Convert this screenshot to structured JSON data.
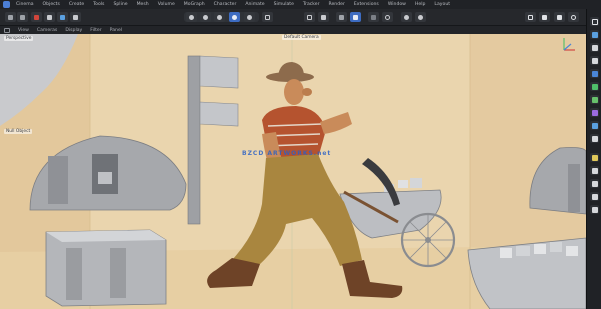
{
  "menubar": {
    "items": [
      "Cinema",
      "Objects",
      "Create",
      "Tools",
      "Spline",
      "Mesh",
      "Volume",
      "MoGraph",
      "Character",
      "Animate",
      "Simulate",
      "Tracker",
      "Render",
      "Extensions",
      "Window",
      "Help",
      "Layout"
    ]
  },
  "viewport_bar": {
    "items": [
      "View",
      "Cameras",
      "Display",
      "Filter",
      "Panel"
    ]
  },
  "viewport": {
    "view_label": "Perspective",
    "camera_label": "Default Camera",
    "tag_left": "Null Object",
    "watermark": "BZCD ARTWORKS.net"
  },
  "colors": {
    "accent": "#3d6cc2",
    "wall": "#ead5ae",
    "floor": "#e7cfa3",
    "shirt": "#b5532f",
    "trousers": "#a9863f",
    "boots": "#6e4327",
    "hat": "#8d6b4c",
    "skin": "#c98b5a",
    "props": "#a7a9ad"
  }
}
